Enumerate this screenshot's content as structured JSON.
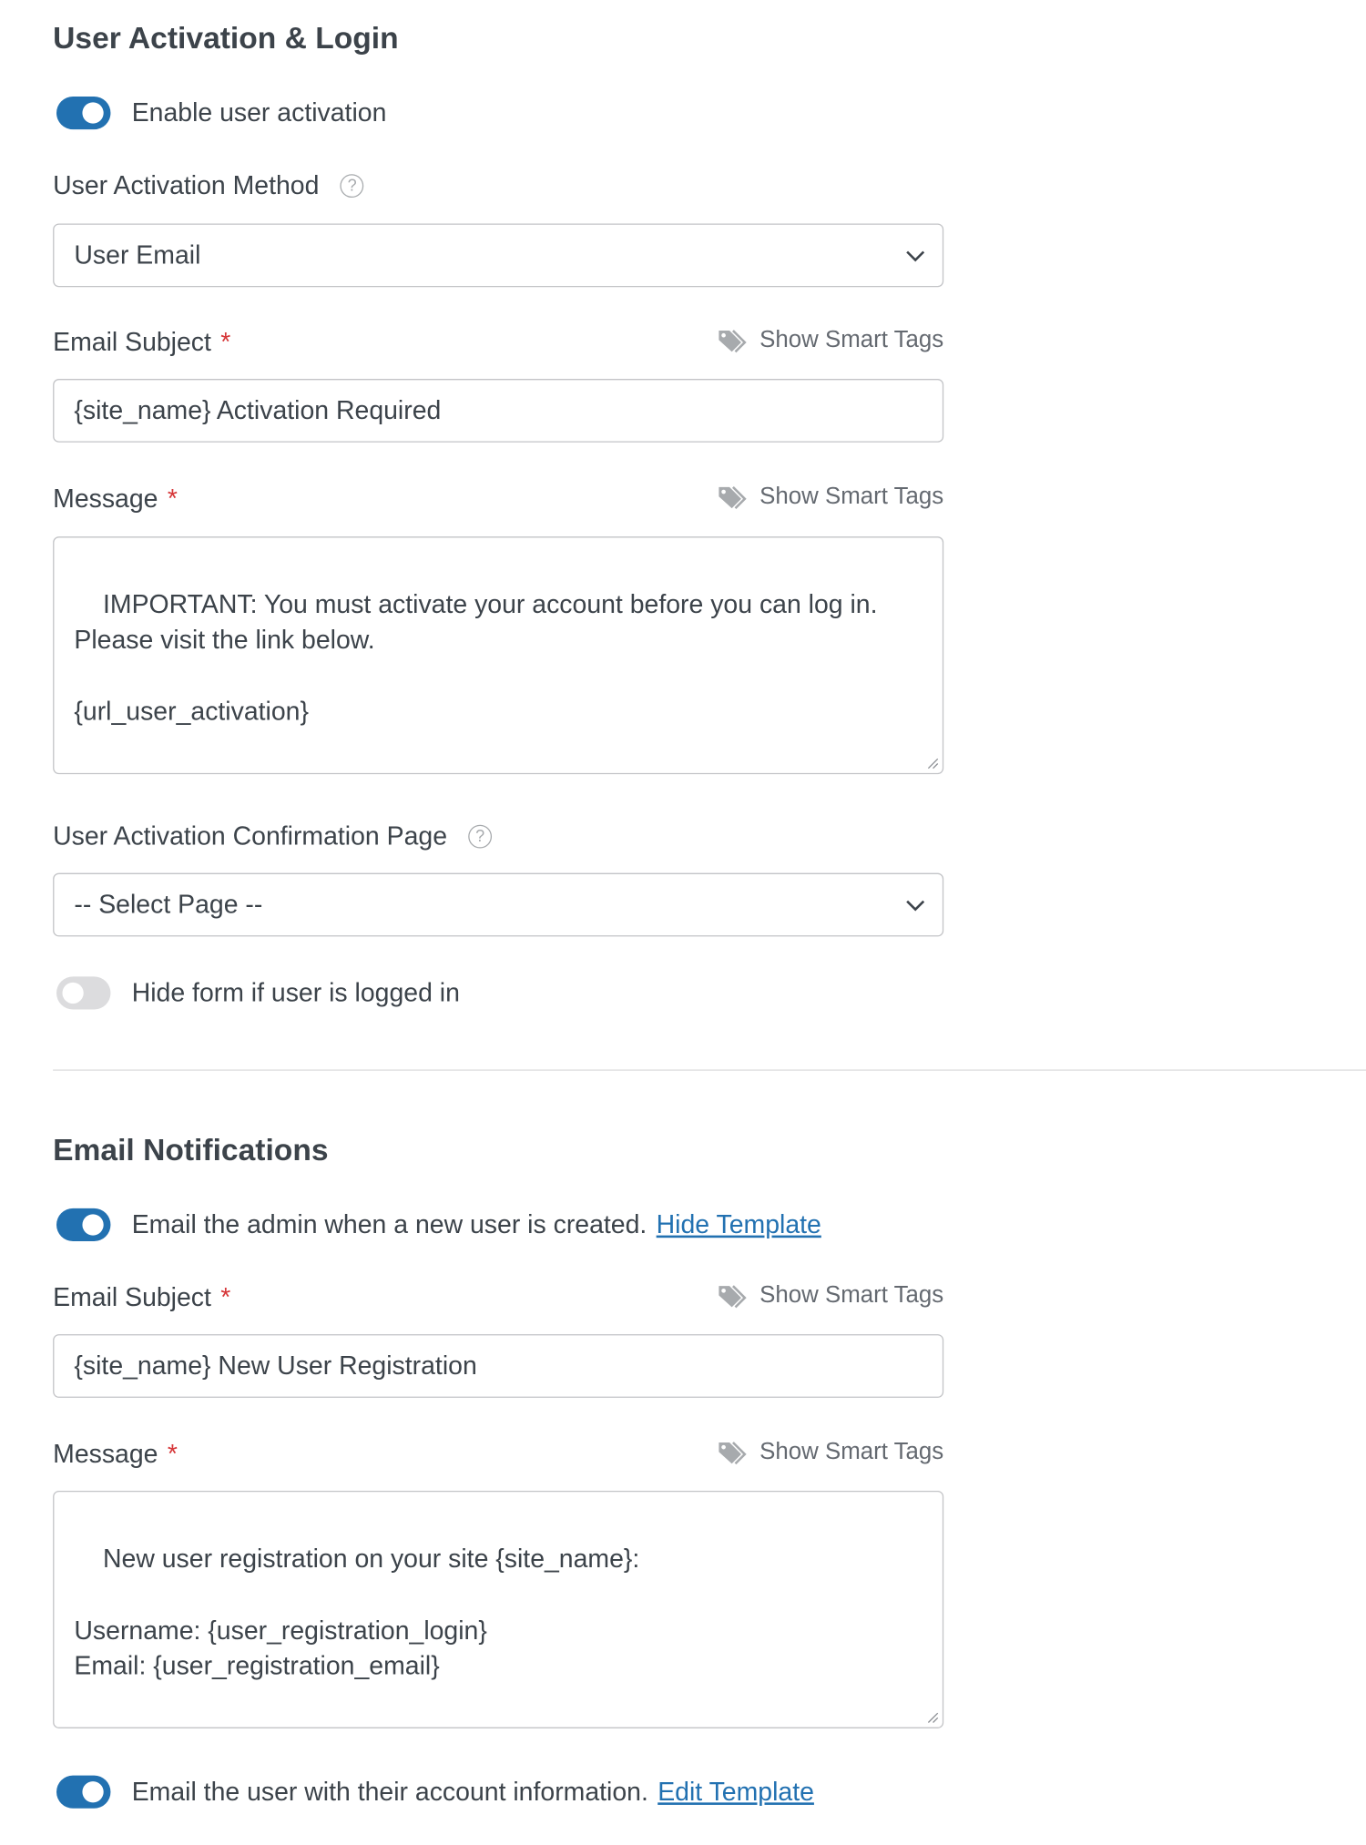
{
  "activation": {
    "title": "User Activation & Login",
    "enable_label": "Enable user activation",
    "enable_on": true,
    "method_label": "User Activation Method",
    "method_value": "User Email",
    "subject_label": "Email Subject",
    "subject_value": "{site_name} Activation Required",
    "message_label": "Message",
    "message_value": "IMPORTANT: You must activate your account before you can log in.\nPlease visit the link below.\n\n{url_user_activation}",
    "confirm_label": "User Activation Confirmation Page",
    "confirm_value": "-- Select Page --",
    "hide_form_label": "Hide form if user is logged in",
    "hide_form_on": false
  },
  "notifications": {
    "title": "Email Notifications",
    "admin_label": "Email the admin when a new user is created.",
    "admin_link": "Hide Template",
    "admin_on": true,
    "subject_label": "Email Subject",
    "subject_value": "{site_name} New User Registration",
    "message_label": "Message",
    "message_value": "New user registration on your site {site_name}:\n\nUsername: {user_registration_login}\nEmail: {user_registration_email}",
    "user_label": "Email the user with their account information.",
    "user_link": "Edit Template",
    "user_on": true
  },
  "common": {
    "smart_tags": "Show Smart Tags",
    "required": "*",
    "help": "?"
  },
  "colors": {
    "accent": "#2271b1",
    "required": "#d63638",
    "text": "#3c434a"
  }
}
